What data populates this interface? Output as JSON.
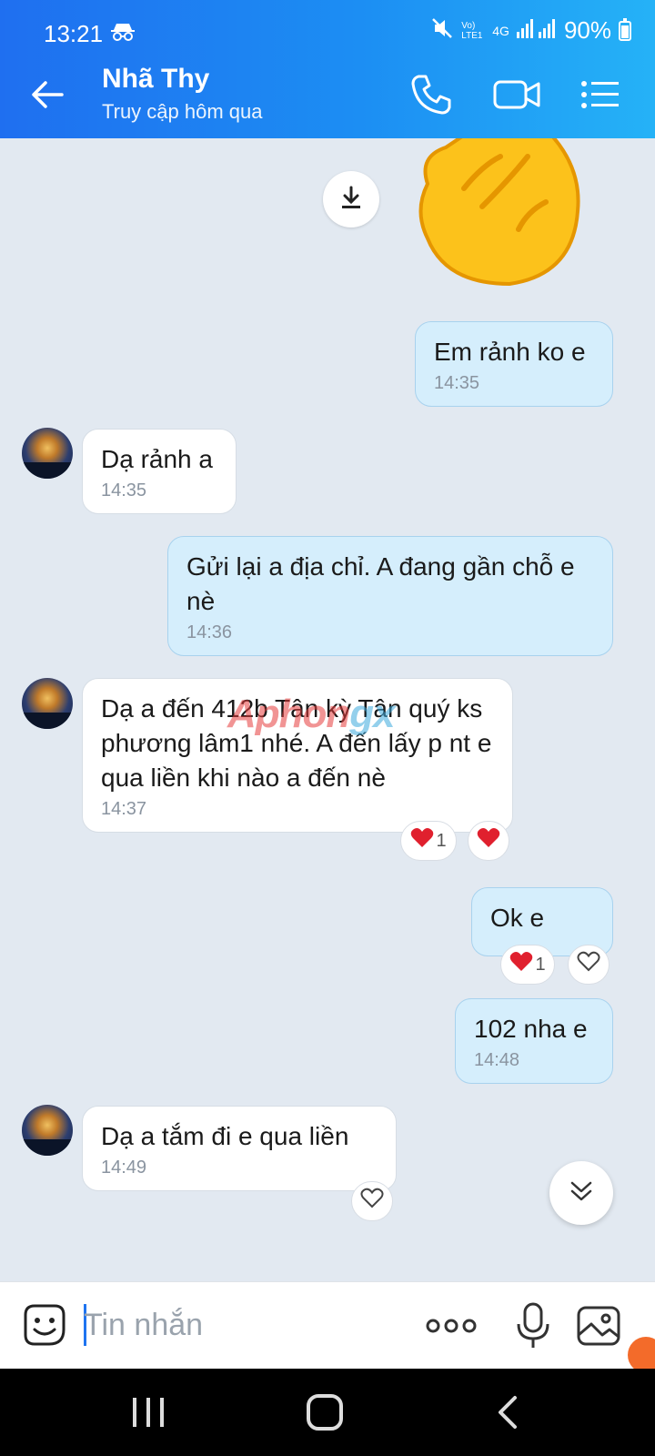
{
  "status_bar": {
    "time": "13:21",
    "network": "4G",
    "lte_label": "Vo) LTE1",
    "battery": "90%"
  },
  "header": {
    "contact_name": "Nhã Thy",
    "contact_status": "Truy cập hôm qua"
  },
  "messages": [
    {
      "direction": "out",
      "text": "Em rảnh ko e",
      "time": "14:35"
    },
    {
      "direction": "in",
      "text": "Dạ rảnh a",
      "time": "14:35"
    },
    {
      "direction": "out",
      "text": "Gửi lại a địa chỉ. A đang gần chỗ e nè",
      "time": "14:36"
    },
    {
      "direction": "in",
      "text": "Dạ a đến 412b Tân kỳ Tân quý ks phương lâm1 nhé. A đến lấy p nt e qua liền khi nào a đến nè",
      "time": "14:37",
      "reaction_count": "1"
    },
    {
      "direction": "out",
      "text": "Ok e",
      "reaction_count": "1"
    },
    {
      "direction": "out",
      "text": "102 nha e",
      "time": "14:48"
    },
    {
      "direction": "in",
      "text": "Dạ a tắm đi e qua liền",
      "time": "14:49"
    }
  ],
  "watermark": {
    "part1": "Aphon",
    "part2": "gx"
  },
  "input": {
    "placeholder": "Tin nhắn"
  },
  "colors": {
    "accent": "#1f74f0",
    "bubble_out": "#d5eefc",
    "bubble_in": "#ffffff",
    "background": "#e2e9f1",
    "heart": "#e0202e"
  },
  "icons": [
    "back-arrow-icon",
    "phone-icon",
    "video-call-icon",
    "menu-icon",
    "download-icon",
    "waving-hand-icon",
    "heart-icon",
    "heart-outline-icon",
    "double-chevron-down-icon",
    "sticker-icon",
    "more-dots-icon",
    "microphone-icon",
    "image-icon",
    "nav-recent-icon",
    "nav-home-icon",
    "nav-back-icon"
  ]
}
